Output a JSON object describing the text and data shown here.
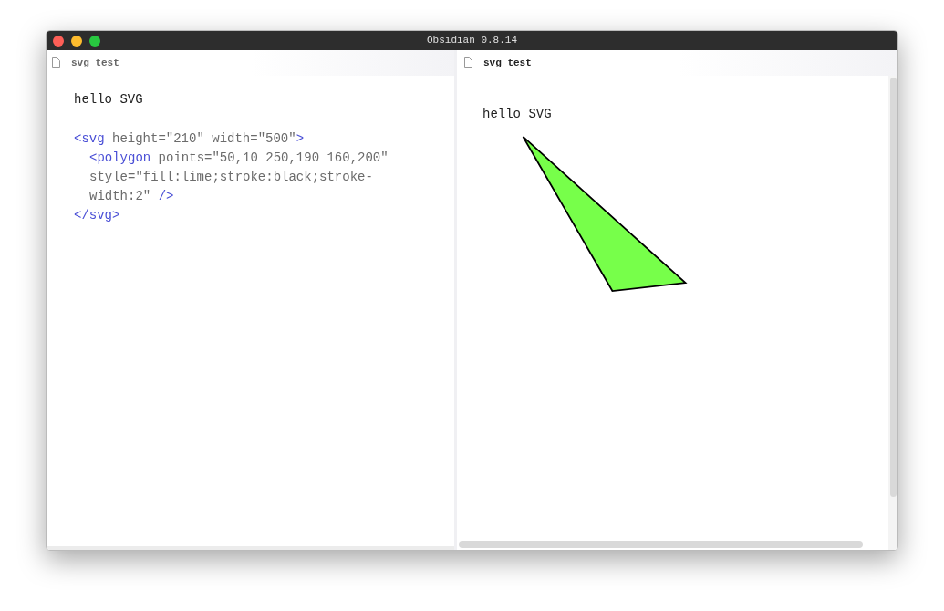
{
  "window": {
    "title": "Obsidian 0.8.14"
  },
  "editor": {
    "tab_title": "svg test",
    "heading": "hello SVG",
    "code_lines": [
      {
        "segments": [
          {
            "kind": "tag",
            "text": "<svg"
          },
          {
            "kind": "attr",
            "text": " height=\"210\" width=\"500\""
          },
          {
            "kind": "tag",
            "text": ">"
          }
        ],
        "children": [
          {
            "segments": [
              {
                "kind": "tag",
                "text": "<polygon"
              },
              {
                "kind": "attr",
                "text": " points=\"50,10 250,190 160,200\""
              }
            ]
          },
          {
            "segments": [
              {
                "kind": "attr",
                "text": "style=\"fill:lime;stroke:black;stroke-"
              }
            ]
          },
          {
            "segments": [
              {
                "kind": "attr",
                "text": "width:2\" "
              },
              {
                "kind": "tag",
                "text": "/>"
              }
            ]
          }
        ]
      },
      {
        "segments": [
          {
            "kind": "tag",
            "text": "</svg>"
          }
        ]
      }
    ]
  },
  "preview": {
    "tab_title": "svg test",
    "heading": "hello SVG"
  }
}
